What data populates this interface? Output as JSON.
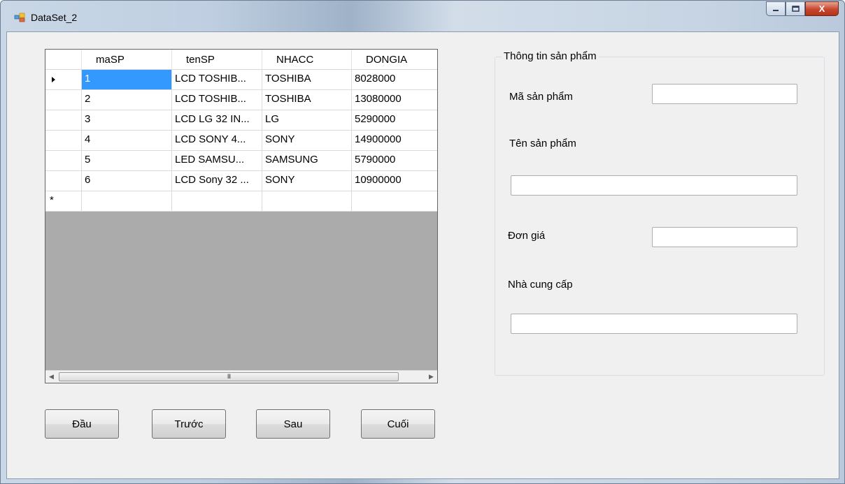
{
  "window": {
    "title": "DataSet_2",
    "close_glyph": "X"
  },
  "grid": {
    "columns": [
      "maSP",
      "tenSP",
      "NHACC",
      "DONGIA"
    ],
    "rows": [
      [
        "1",
        "LCD TOSHIB...",
        "TOSHIBA",
        "8028000"
      ],
      [
        "2",
        "LCD TOSHIB...",
        "TOSHIBA",
        "13080000"
      ],
      [
        "3",
        "LCD LG 32 IN...",
        "LG",
        "5290000"
      ],
      [
        "4",
        "LCD SONY 4...",
        "SONY",
        "14900000"
      ],
      [
        "5",
        "LED SAMSU...",
        "SAMSUNG",
        "5790000"
      ],
      [
        "6",
        "LCD Sony 32 ...",
        "SONY",
        "10900000"
      ]
    ],
    "new_row_marker": "*",
    "scroll_grip": "III"
  },
  "buttons": {
    "first": "Đầu",
    "prev": "Trước",
    "next": "Sau",
    "last": "Cuối"
  },
  "info": {
    "group_title": "Thông tin sản phẩm",
    "ma_label": "Mã sản phẩm",
    "ten_label": "Tên sản phẩm",
    "gia_label": "Đơn giá",
    "ncc_label": "Nhà cung cấp",
    "ma_value": "",
    "ten_value": "",
    "gia_value": "",
    "ncc_value": ""
  }
}
